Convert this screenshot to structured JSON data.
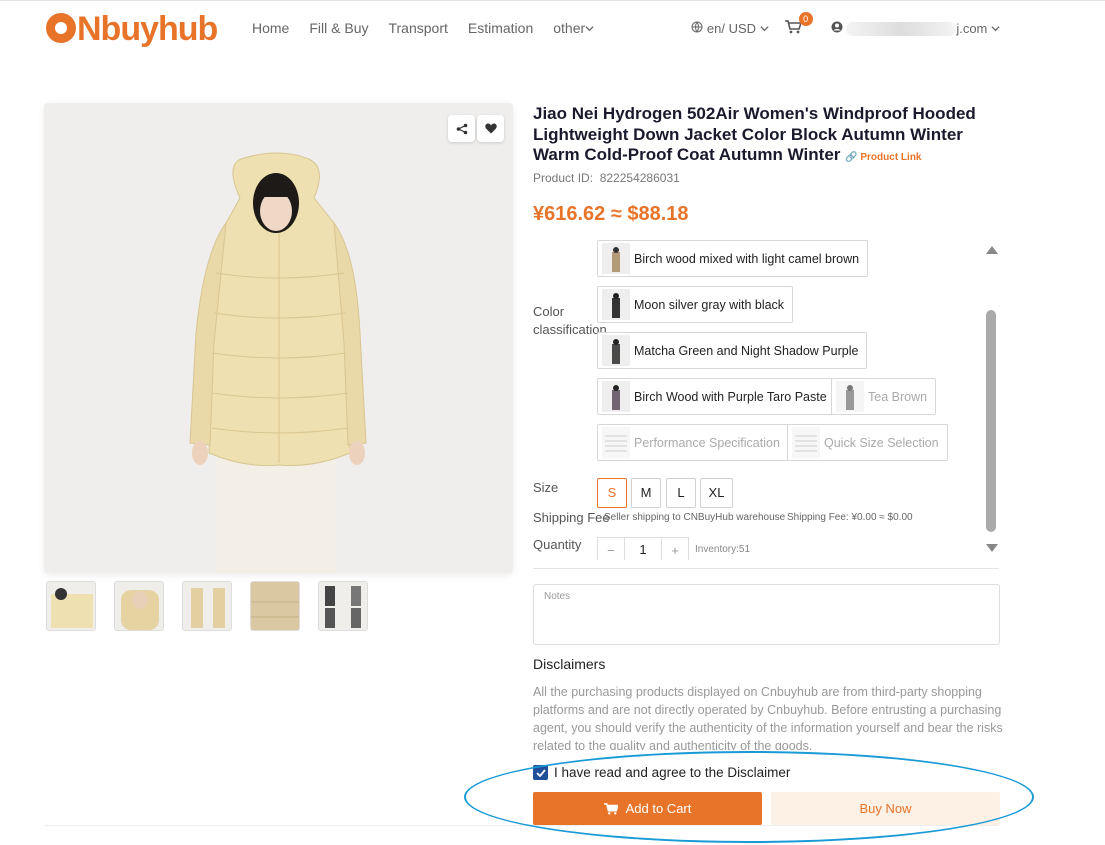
{
  "header": {
    "logo_text": "Nbuyhub",
    "nav": [
      "Home",
      "Fill & Buy",
      "Transport",
      "Estimation",
      "other"
    ],
    "locale": "en/ USD",
    "cart_count": "0",
    "account_suffix": "j.com"
  },
  "product": {
    "title": "Jiao Nei Hydrogen 502Air Women's Windproof Hooded Lightweight Down Jacket Color Block Autumn Winter Warm Cold-Proof Coat Autumn Winter",
    "product_link_label": "Product Link",
    "id_label": "Product ID:",
    "id_value": "822254286031",
    "price": "¥616.62 ≈ $88.18"
  },
  "options": {
    "color_label": "Color classification",
    "colors": [
      {
        "label": "Birch wood mixed with light camel brown",
        "available": true
      },
      {
        "label": "Moon silver gray with black",
        "available": true
      },
      {
        "label": "Matcha Green and Night Shadow Purple",
        "available": true
      },
      {
        "label": "Birch Wood with Purple Taro Paste",
        "available": true
      },
      {
        "label": "Tea Brown",
        "available": false
      },
      {
        "label": "Performance Specification",
        "available": false
      },
      {
        "label": "Quick Size Selection",
        "available": false
      }
    ],
    "size_label": "Size",
    "sizes": [
      "S",
      "M",
      "L",
      "XL"
    ],
    "selected_size": "S",
    "shipping_label": "Shipping Fee",
    "shipping_route": "Seller shipping to CNBuyHub warehouse",
    "shipping_fee": "Shipping Fee: ¥0.00 ≈ $0.00",
    "quantity_label": "Quantity",
    "quantity": "1",
    "inventory": "Inventory:51"
  },
  "notes_placeholder": "Notes",
  "disclaimer": {
    "title": "Disclaimers",
    "text": "All the purchasing products displayed on Cnbuyhub are from third-party shopping platforms and are not directly operated by Cnbuyhub. Before entrusting a purchasing agent, you should verify the authenticity of the information yourself and bear the risks related to the quality and authenticity of the goods.",
    "agree_label": "I have read and agree to the Disclaimer"
  },
  "actions": {
    "add_to_cart": "Add to Cart",
    "buy_now": "Buy Now"
  },
  "colors": {
    "accent": "#e8742a",
    "checkbox": "#1f4e9b",
    "annotation": "#1a9ad6"
  }
}
